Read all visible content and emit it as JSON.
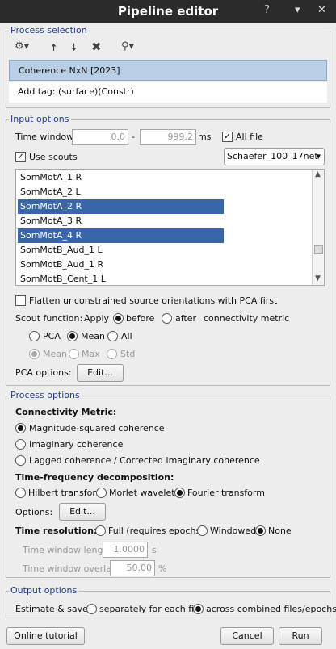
{
  "window": {
    "title": "Pipeline editor",
    "help": "?",
    "minimize": "▾",
    "close": "✕"
  },
  "process_selection": {
    "label": "Process selection",
    "processes": [
      "Coherence NxN [2023]",
      "Add tag: (surface)(Constr)"
    ]
  },
  "input_options": {
    "label": "Input options",
    "time_window_label": "Time window:",
    "time_start": "0.0",
    "time_end": "999.2",
    "time_dash": "-",
    "time_unit": "ms",
    "all_file_label": "All file",
    "use_scouts_label": "Use scouts",
    "atlas": "Schaefer_100_17net",
    "scouts": [
      "SomMotA_1 R",
      "SomMotA_2 L",
      "SomMotA_2 R",
      "SomMotA_3 R",
      "SomMotA_4 R",
      "SomMotB_Aud_1 L",
      "SomMotB_Aud_1 R",
      "SomMotB_Cent_1 L"
    ],
    "selected_scouts": [
      "SomMotA_2 R",
      "SomMotA_4 R"
    ],
    "flatten_label": "Flatten unconstrained source orientations with PCA first",
    "scout_function_label": "Scout function:",
    "apply_label": "Apply",
    "before_label": "before",
    "after_label": "after",
    "connectivity_metric_label": "connectivity metric",
    "func_pca": "PCA",
    "func_mean": "Mean",
    "func_all": "All",
    "sub_mean": "Mean",
    "sub_max": "Max",
    "sub_std": "Std",
    "pca_options_label": "PCA options:",
    "edit_label": "Edit..."
  },
  "process_options": {
    "label": "Process options",
    "connectivity_metric_heading": "Connectivity Metric:",
    "metric_msc": "Magnitude-squared coherence",
    "metric_imag": "Imaginary coherence",
    "metric_lagged": "Lagged coherence / Corrected imaginary coherence",
    "tf_heading": "Time-frequency decomposition:",
    "tf_hilbert": "Hilbert transform",
    "tf_morlet": "Morlet wavelets",
    "tf_fourier": "Fourier transform",
    "options_label": "Options:",
    "edit_label": "Edit...",
    "time_resolution_heading": "Time resolution:",
    "tr_full": "Full (requires epochs)",
    "tr_windowed": "Windowed",
    "tr_none": "None",
    "tw_length_label": "Time window length:",
    "tw_length_value": "1.0000",
    "tw_length_unit": "s",
    "tw_overlap_label": "Time window overlap:",
    "tw_overlap_value": "50.00",
    "tw_overlap_unit": "%"
  },
  "output_options": {
    "label": "Output options",
    "estimate_save_label": "Estimate & save:",
    "separately_label": "separately for each file",
    "across_label": "across combined files/epochs"
  },
  "footer": {
    "tutorial_label": "Online tutorial",
    "cancel_label": "Cancel",
    "run_label": "Run"
  }
}
